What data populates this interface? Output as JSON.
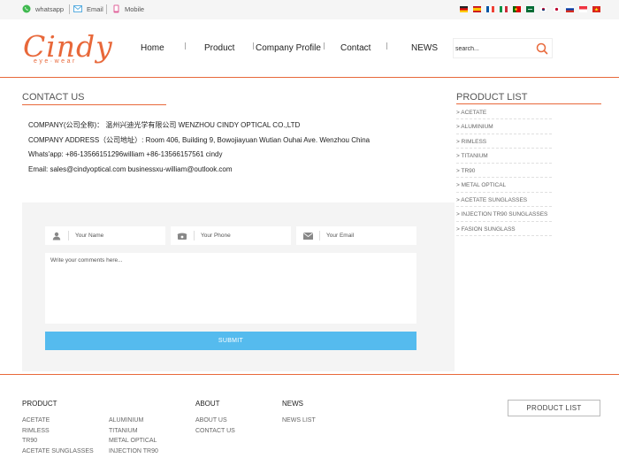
{
  "topbar": {
    "whatsapp": "whatsapp",
    "email": "Email",
    "mobile": "Mobile",
    "flags": [
      "de-flag",
      "es-flag",
      "fr-flag",
      "it-flag",
      "pt-flag",
      "sa-flag",
      "kr-flag",
      "jp-flag",
      "ru-flag",
      "sg-flag",
      "vn-flag"
    ]
  },
  "header": {
    "logo_script": "Cindy",
    "logo_sub": "eye·wear",
    "nav": [
      "Home",
      "Product",
      "Company Profile",
      "Contact",
      "NEWS"
    ],
    "search_placeholder": "search..."
  },
  "contact": {
    "title": "CONTACT US",
    "company": "COMPANY(公司全称)：  温州兴迪光学有限公司 WENZHOU CINDY OPTICAL CO.,LTD",
    "address": "COMPANY ADDRESS（公司地址）: Room 406, Building 9, Bowojiayuan Wutian Ouhai Ave. Wenzhou China",
    "whatsapp": "Whats'app:  +86-13566151296william      +86-13566157561 cindy",
    "email": "Email:  sales@cindyoptical.com        businessxu-william@outlook.com"
  },
  "form": {
    "name_placeholder": "Your Name",
    "phone_placeholder": "Your Phone",
    "email_placeholder": "Your Email",
    "comments_placeholder": "Write your comments here...",
    "submit": "SUBMIT"
  },
  "product_list": {
    "title": "PRODUCT LIST",
    "items": [
      "> ACETATE",
      "> ALUMINIUM",
      "> RIMLESS",
      "> TITANIUM",
      "> TR90",
      "> METAL OPTICAL",
      "> ACETATE SUNGLASSES",
      "> INJECTION TR90 SUNGLASSES",
      "> FASION SUNGLASS"
    ]
  },
  "footer": {
    "product_title": "PRODUCT",
    "product_col1": [
      "ACETATE",
      "RIMLESS",
      "TR90",
      "ACETATE SUNGLASSES"
    ],
    "product_col2": [
      "ALUMINIUM",
      "TITANIUM",
      "METAL OPTICAL",
      "INJECTION TR90"
    ],
    "about_title": "ABOUT",
    "about_links": [
      "ABOUT US",
      "CONTACT US"
    ],
    "news_title": "NEWS",
    "news_links": [
      "NEWS LIST"
    ],
    "product_list_button": "PRODUCT LIST"
  },
  "colors": {
    "accent": "#e8683a",
    "submit": "#55bbee",
    "panel": "#f4f4f4"
  }
}
